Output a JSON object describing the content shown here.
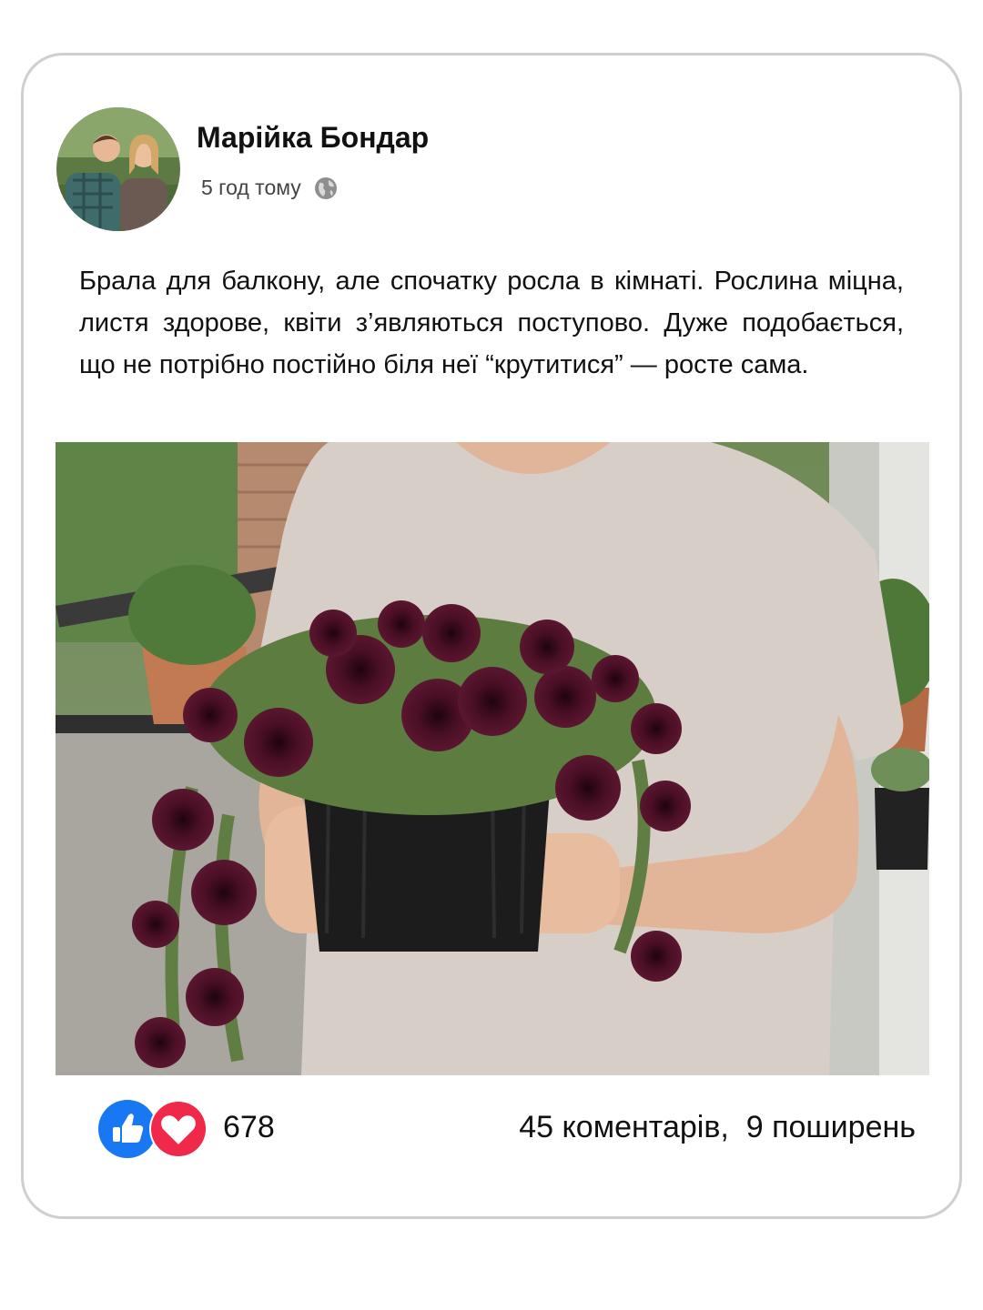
{
  "post": {
    "author": "Марійка Бондар",
    "time": "5 год тому",
    "privacy_icon": "globe-icon",
    "text": "Брала для балкону, але спочатку росла в кімнаті. Рослина міцна, листя здорове, квіти з’являються поступово. Дуже подобається, що не потрібно постійно біля неї “крутитися” — росте сама."
  },
  "reactions": {
    "icons": [
      "like-icon",
      "love-icon"
    ],
    "like_color": "#1877f2",
    "love_color": "#f02849",
    "count": "678"
  },
  "stats": {
    "comments": "45 коментарів,",
    "shares": "9 поширень"
  },
  "colors": {
    "border": "#cfcfcf",
    "petunia": "#4a0f24"
  }
}
